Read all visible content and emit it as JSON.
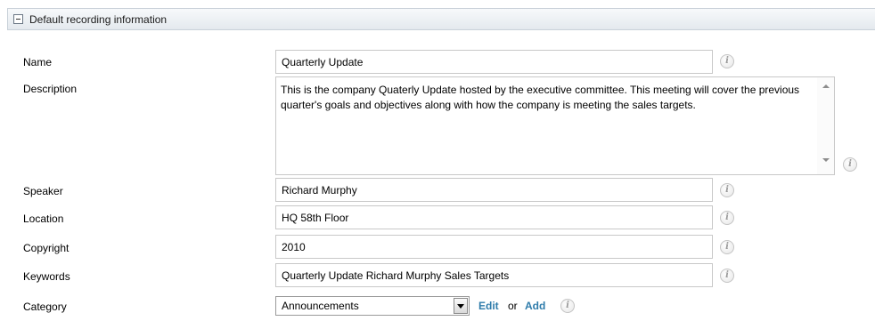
{
  "section": {
    "title": "Default recording information",
    "toggle_icon": "collapse-minus-icon"
  },
  "fields": {
    "name": {
      "label": "Name",
      "value": "Quarterly Update"
    },
    "description": {
      "label": "Description",
      "value": "This is the company Quaterly Update hosted by the executive committee.  This meeting will cover the previous quarter's goals and objectives along with how the company is meeting the sales targets."
    },
    "speaker": {
      "label": "Speaker",
      "value": "Richard Murphy"
    },
    "location": {
      "label": "Location",
      "value": "HQ 58th Floor"
    },
    "copyright": {
      "label": "Copyright",
      "value": "2010"
    },
    "keywords": {
      "label": "Keywords",
      "value": "Quarterly Update Richard Murphy Sales Targets"
    },
    "category": {
      "label": "Category",
      "value": "Announcements",
      "edit_label": "Edit",
      "or_label": "or",
      "add_label": "Add"
    }
  },
  "icons": {
    "info": "i",
    "info_icon_name": "info-icon"
  },
  "colors": {
    "link": "#2f7cab",
    "header_bg": "#e9eef3",
    "border": "#c8c8c8"
  }
}
